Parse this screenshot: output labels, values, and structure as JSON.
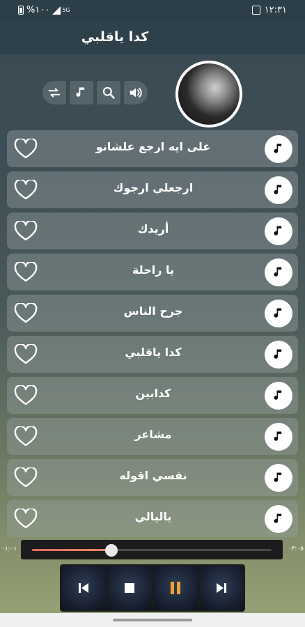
{
  "status": {
    "battery": "%١٠٠",
    "network": "5G",
    "time": "١٢:٣١"
  },
  "header": {
    "title": "كدا ياقلبي"
  },
  "toolbar": [
    {
      "name": "repeat-icon"
    },
    {
      "name": "music-note-icon"
    },
    {
      "name": "search-icon"
    },
    {
      "name": "volume-icon"
    }
  ],
  "songs": [
    {
      "title": "على ايه ارجع علشانو"
    },
    {
      "title": "ارجعلي ارجوك"
    },
    {
      "title": "أريدك"
    },
    {
      "title": "يا راحلة"
    },
    {
      "title": "جرح الناس"
    },
    {
      "title": "كدا ياقلبي"
    },
    {
      "title": "كدابين"
    },
    {
      "title": "مشاعر"
    },
    {
      "title": "نفسي اقوله"
    },
    {
      "title": "ياليالي"
    }
  ],
  "player": {
    "elapsed": "٠١:٠١",
    "duration": "٠٣:٠٥",
    "progress": 0.33,
    "buttons": [
      "previous-icon",
      "stop-icon",
      "pause-icon",
      "next-icon"
    ]
  },
  "colors": {
    "accent": "#e07a5f",
    "pause": "#f0a030",
    "header": "#2e414b"
  }
}
